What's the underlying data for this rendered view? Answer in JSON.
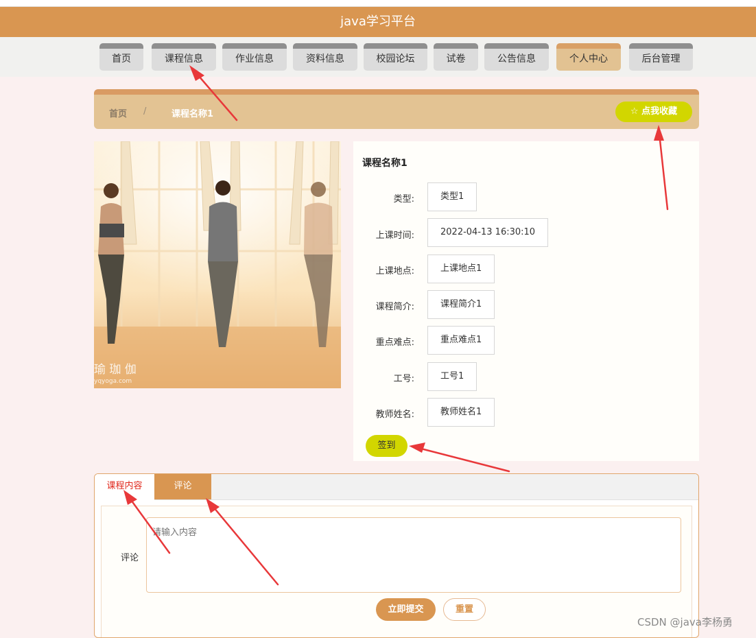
{
  "app": {
    "title": "java学习平台"
  },
  "nav": {
    "items": [
      {
        "label": "首页"
      },
      {
        "label": "课程信息"
      },
      {
        "label": "作业信息"
      },
      {
        "label": "资料信息"
      },
      {
        "label": "校园论坛"
      },
      {
        "label": "试卷"
      },
      {
        "label": "公告信息"
      },
      {
        "label": "个人中心",
        "active": true
      },
      {
        "label": "后台管理"
      }
    ]
  },
  "breadcrumb": {
    "home": "首页",
    "separator": "/",
    "current": "课程名称1"
  },
  "favorite": {
    "label": "☆ 点我收藏"
  },
  "course": {
    "title": "课程名称1",
    "fields": [
      {
        "label": "类型:",
        "value": "类型1"
      },
      {
        "label": "上课时间:",
        "value": "2022-04-13 16:30:10"
      },
      {
        "label": "上课地点:",
        "value": "上课地点1"
      },
      {
        "label": "课程简介:",
        "value": "课程简介1"
      },
      {
        "label": "重点难点:",
        "value": "重点难点1"
      },
      {
        "label": "工号:",
        "value": "工号1"
      },
      {
        "label": "教师姓名:",
        "value": "教师姓名1"
      }
    ],
    "signin_label": "签到"
  },
  "photo": {
    "watermark_text": "瑜 珈 伽",
    "watermark_url": "yqyoga.com"
  },
  "tabs": [
    {
      "label": "课程内容"
    },
    {
      "label": "评论"
    }
  ],
  "comment": {
    "label": "评论",
    "placeholder": "请输入内容",
    "submit_label": "立即提交",
    "reset_label": "重置"
  },
  "watermark": "CSDN @java李杨勇",
  "colors": {
    "brand": "#d99651",
    "accent_yellow": "#d2d600",
    "annotation_red": "#e8383a"
  }
}
